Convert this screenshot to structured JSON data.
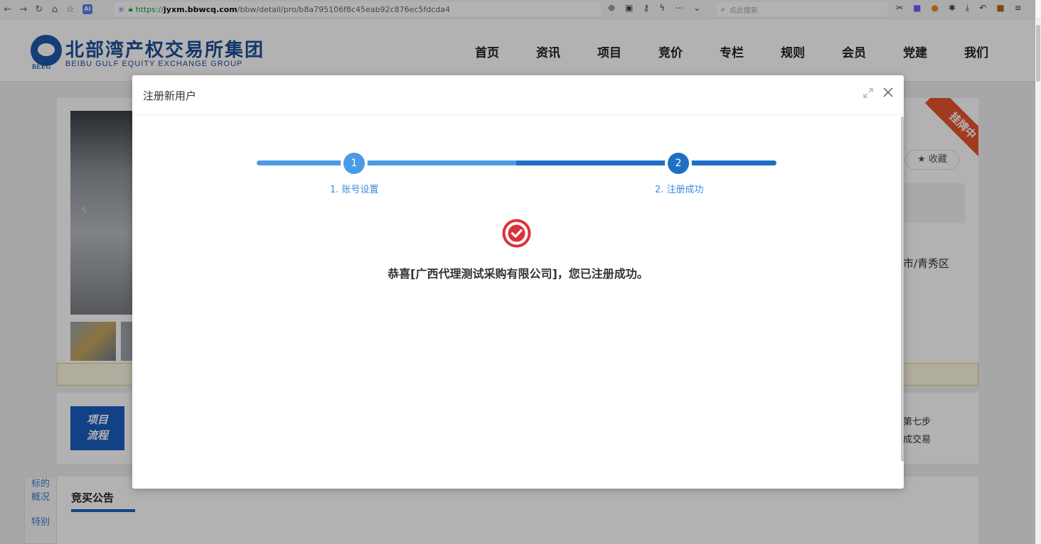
{
  "browser": {
    "url_protocol": "https://",
    "url_host": "jyxm.bbwcq.com",
    "url_path": "/bbw/detail/pro/b8a795106f8c45eab92c876ec5fdcda4",
    "search_placeholder": "点此搜索",
    "ai_badge": "AI"
  },
  "site": {
    "logo_cn": "北部湾产权交易所集团",
    "logo_en": "BEIBU GULF EQUITY EXCHANGE GROUP",
    "logo_abbr": "BEEG",
    "nav": [
      "首页",
      "资讯",
      "项目",
      "竞价",
      "专栏",
      "规则",
      "会员",
      "党建",
      "我们"
    ]
  },
  "background": {
    "status_ribbon": "挂牌中",
    "favorite_label": "收藏",
    "favorite_icon": "star-icon",
    "region_text": "市/青秀区",
    "flow_badge_line1": "项目",
    "flow_badge_line2": "流程",
    "step7_text": "第七步",
    "deal_text": "成交易",
    "side_tab_line1": "标的",
    "side_tab_line2": "概况",
    "side_tab_line3": "特别",
    "active_tab": "竞买公告"
  },
  "modal": {
    "title": "注册新用户",
    "steps": [
      {
        "number": "1",
        "label": "1. 账号设置"
      },
      {
        "number": "2",
        "label": "2. 注册成功"
      }
    ],
    "success_message": "恭喜[广西代理测试采购有限公司]，您已注册成功。",
    "success_color": "#d9323b",
    "step_done_color": "#4a9be6",
    "step_current_color": "#1f6fc6"
  }
}
